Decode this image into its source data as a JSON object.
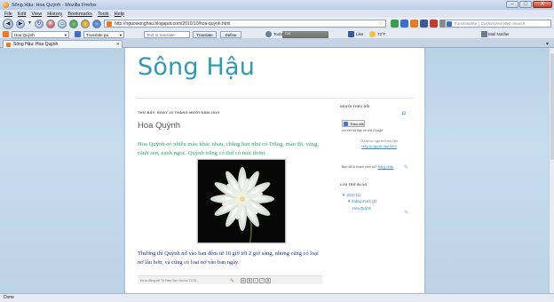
{
  "window": {
    "title": "Sông Hậu: Hoa Quỳnh - Mozilla Firefox",
    "controls": [
      "–",
      "□",
      "X"
    ]
  },
  "menu": [
    "File",
    "Edit",
    "View",
    "History",
    "Bookmarks",
    "Tools",
    "Help"
  ],
  "nav": {
    "url": "http://nguoisonghau.blogspot.com/2010/10/hoa-quynh.html",
    "search_placeholder": "TranslatorBar | Customized Web Search"
  },
  "toolbar": {
    "select_value": "Hoa Quỳnh",
    "translate_select": "Translate pa",
    "text_input_placeholder": "Text to translate",
    "translate_button": "Translate",
    "define_button": "Define",
    "tools_label": "Tools",
    "weather_text": "Cell",
    "like_label": "Like",
    "temp_label": "72°F",
    "mail_label": "Mail Notifier"
  },
  "tabs": [
    {
      "label": "Sông Hậu: Hoa Quỳnh"
    }
  ],
  "blog": {
    "title": "Sông Hậu",
    "date_header": "THỨ BẢY, NGÀY 23 THÁNG MƯỜI NĂM 2010",
    "post_title": "Hoa Quỳnh",
    "paragraph1": "Hoa Quỳnh có nhiều màu khác nhau, chẳng hạn như có Trắng, màu đỏ, vàng, cánh sen, xanh ngọc. Quỳnh trắng có thứ có mùi thơm.",
    "paragraph2": "Thường thì Quỳnh nở vào ban đêm từ 10 giờ tới 2 giờ sáng, nhưng cũng có loại nở lâu hơn, và cũng có loại nở vào ban ngày.",
    "footer_by": "Được đăng bởi Tư Nam Sơn vào lúc 11:26",
    "share_buttons": [
      "M",
      "B",
      "t",
      "f",
      "B"
    ]
  },
  "sidebar": {
    "followers_title": "NGƯỜI THEO DÕI",
    "follow_button": "Theo dõi",
    "follow_via": "với Kết nối Bạn bè của Google",
    "empty_text": "Chưa có người theo dõi.",
    "empty_link": "Hãy là người đầu tiên!",
    "member_text": "Bạn đã là thành viên rồi?",
    "member_link": "Đăng nhập",
    "archive_title": "LƯU TRỮ BLOG",
    "archive_year": "2010",
    "archive_year_count": "(1)",
    "archive_month": "tháng mười",
    "archive_month_count": "(1)",
    "archive_post": "Hoa Quỳnh"
  },
  "status": "Done",
  "colors": {
    "blog_title": "#2e9ab8",
    "paragraph1": "#2aa36a",
    "paragraph2": "#1f2c9a",
    "link": "#2a8ac4"
  }
}
